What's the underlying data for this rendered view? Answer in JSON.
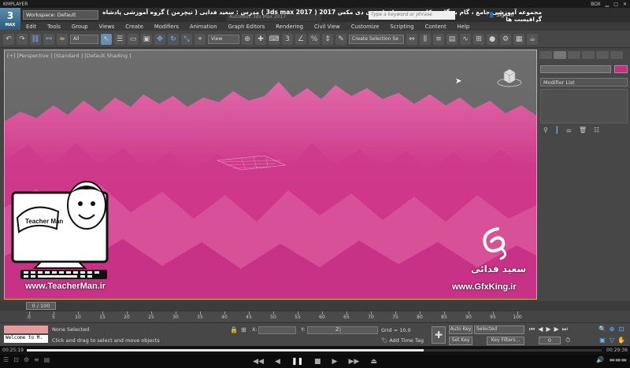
{
  "player": {
    "name": "KMPLAYER",
    "box_label": "BOX",
    "time_elapsed": "00:25:19",
    "time_total": "00:29:36",
    "progress": 0.69
  },
  "app": {
    "logo_text": "3",
    "logo_sub": "MAX",
    "workspace": "Workspace: Default",
    "persian_title": "مجموعه آموزشی جامع ، گام به گام و کاربردی نرم افزار تری دی مکس 2017 ( 3ds max 2017 )  مدرس : سعید فدایی ( تیچرمن ) گروه آموزشی پادشاه گرافیست ها",
    "doc_title": "Autodesk 3ds Max 2017",
    "search_placeholder": "Type a keyword or phrase",
    "signin": "Sign In"
  },
  "menu": [
    "Edit",
    "Tools",
    "Group",
    "Views",
    "Create",
    "Modifiers",
    "Animation",
    "Graph Editors",
    "Rendering",
    "Civil View",
    "Customize",
    "Scripting",
    "Content",
    "Help"
  ],
  "toolbar": {
    "filter": "All",
    "refcoord": "View",
    "selection_set": "Create Selection Se"
  },
  "viewport": {
    "label": "[+] [Perspective ] [Standard ] [Default Shading ]",
    "object_color": "#cc2a85"
  },
  "command_panel": {
    "modifier_list": "Modifier List"
  },
  "timeline": {
    "slider": "0 / 100",
    "ticks": [
      0,
      5,
      10,
      15,
      20,
      25,
      30,
      35,
      40,
      45,
      50,
      55,
      60,
      65,
      70,
      75,
      80,
      85,
      90,
      95,
      100
    ]
  },
  "status": {
    "maxscript_text": "Welcome to M.",
    "selection": "None Selected",
    "prompt": "Click and drag to select and move objects",
    "x_label": "X:",
    "y_label": "Y:",
    "z_label": "Z:",
    "grid": "Grid = 10,0",
    "add_time_tag": "Add Time Tag",
    "auto_key": "Auto Key",
    "set_key": "Set Key",
    "selected": "Selected",
    "key_filters": "Key Filters...",
    "frame": "0"
  },
  "watermarks": {
    "teacher_url": "www.TeacherMan.ir",
    "teacher_name": "Teacher Man",
    "gfx_url": "www.GfxKing.ir",
    "gfx_name": "سعید فدائی"
  }
}
